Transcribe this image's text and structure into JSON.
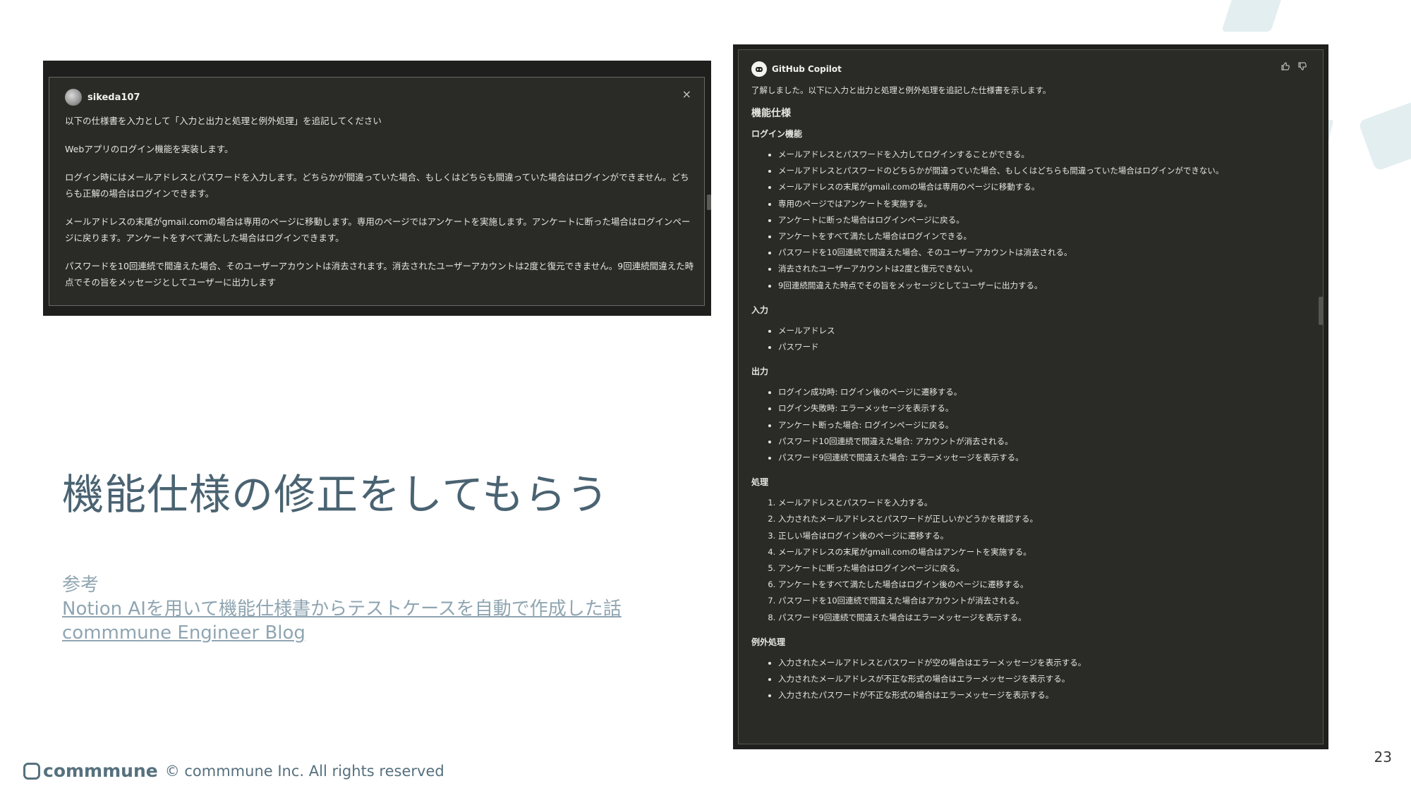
{
  "user_chat": {
    "username": "sikeda107",
    "close_glyph": "×",
    "paragraphs": [
      "以下の仕様書を入力として「入力と出力と処理と例外処理」を追記してください",
      "Webアプリのログイン機能を実装します。",
      "ログイン時にはメールアドレスとパスワードを入力します。どちらかが間違っていた場合、もしくはどちらも間違っていた場合はログインができません。どちらも正解の場合はログインできます。",
      "メールアドレスの末尾がgmail.comの場合は専用のページに移動します。専用のページではアンケートを実施します。アンケートに断った場合はログインページに戻ります。アンケートをすべて満たした場合はログインできます。",
      "パスワードを10回連続で間違えた場合、そのユーザーアカウントは消去されます。消去されたユーザーアカウントは2度と復元できません。9回連続間違えた時点でその旨をメッセージとしてユーザーに出力します"
    ]
  },
  "copilot": {
    "name": "GitHub Copilot",
    "intro": "了解しました。以下に入力と出力と処理と例外処理を追記した仕様書を示します。",
    "heading": "機能仕様",
    "sections": [
      {
        "title": "ログイン機能",
        "ordered": false,
        "items": [
          "メールアドレスとパスワードを入力してログインすることができる。",
          "メールアドレスとパスワードのどちらかが間違っていた場合、もしくはどちらも間違っていた場合はログインができない。",
          "メールアドレスの末尾がgmail.comの場合は専用のページに移動する。",
          "専用のページではアンケートを実施する。",
          "アンケートに断った場合はログインページに戻る。",
          "アンケートをすべて満たした場合はログインできる。",
          "パスワードを10回連続で間違えた場合、そのユーザーアカウントは消去される。",
          "消去されたユーザーアカウントは2度と復元できない。",
          "9回連続間違えた時点でその旨をメッセージとしてユーザーに出力する。"
        ]
      },
      {
        "title": "入力",
        "ordered": false,
        "items": [
          "メールアドレス",
          "パスワード"
        ]
      },
      {
        "title": "出力",
        "ordered": false,
        "items": [
          "ログイン成功時: ログイン後のページに遷移する。",
          "ログイン失敗時: エラーメッセージを表示する。",
          "アンケート断った場合: ログインページに戻る。",
          "パスワード10回連続で間違えた場合: アカウントが消去される。",
          "パスワード9回連続で間違えた場合: エラーメッセージを表示する。"
        ]
      },
      {
        "title": "処理",
        "ordered": true,
        "items": [
          "メールアドレスとパスワードを入力する。",
          "入力されたメールアドレスとパスワードが正しいかどうかを確認する。",
          "正しい場合はログイン後のページに遷移する。",
          "メールアドレスの末尾がgmail.comの場合はアンケートを実施する。",
          "アンケートに断った場合はログインページに戻る。",
          "アンケートをすべて満たした場合はログイン後のページに遷移する。",
          "パスワードを10回連続で間違えた場合はアカウントが消去される。",
          "パスワード9回連続で間違えた場合はエラーメッセージを表示する。"
        ]
      },
      {
        "title": "例外処理",
        "ordered": false,
        "items": [
          "入力されたメールアドレスとパスワードが空の場合はエラーメッセージを表示する。",
          "入力されたメールアドレスが不正な形式の場合はエラーメッセージを表示する。",
          "入力されたパスワードが不正な形式の場合はエラーメッセージを表示する。"
        ]
      }
    ]
  },
  "slide": {
    "title": "機能仕様の修正をしてもらう",
    "ref_label": "参考",
    "ref_link1": "Notion AIを用いて機能仕様書からテストケースを自動で作成した話",
    "ref_link2": "commmune Engineer Blog",
    "brand": "commmune",
    "copyright": "© commmune Inc. All rights reserved",
    "page_number": "23"
  },
  "icons": [
    "user-avatar-icon",
    "close-icon",
    "copilot-logo-icon",
    "thumbs-up-icon",
    "thumbs-down-icon",
    "commmune-logo-icon"
  ]
}
